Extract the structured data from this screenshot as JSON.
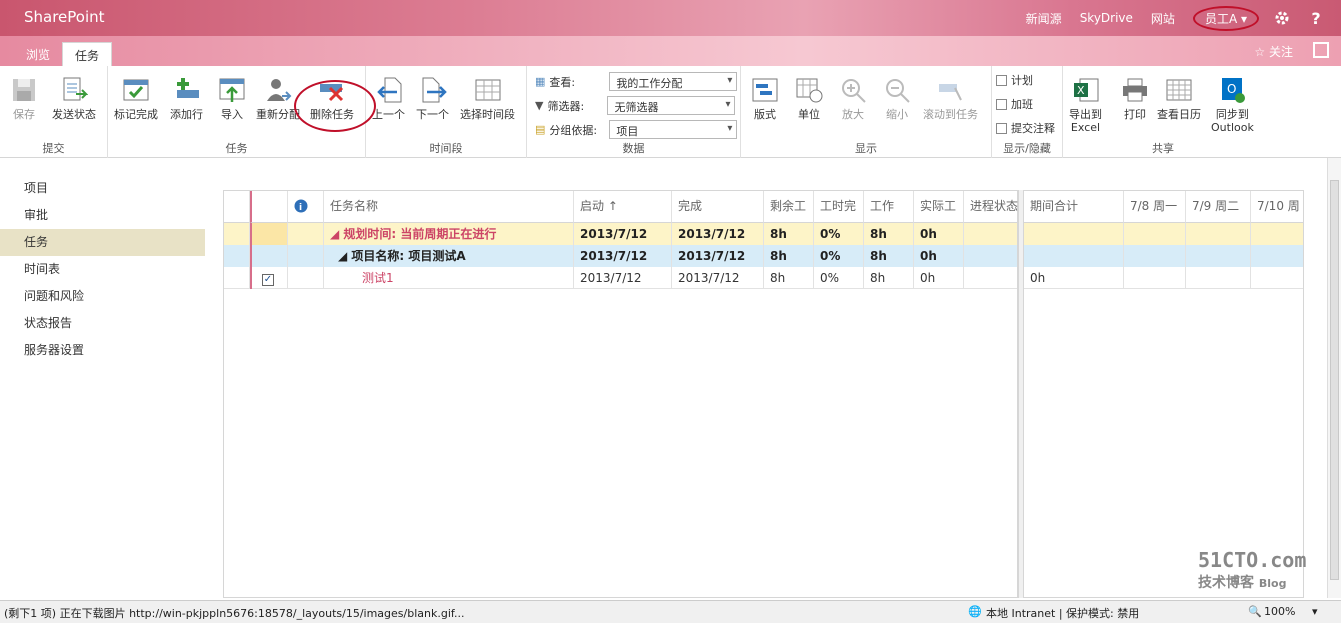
{
  "suite": {
    "brand": "SharePoint",
    "links": [
      "新闻源",
      "SkyDrive",
      "网站"
    ],
    "user": "员工A ▾",
    "settings_icon": "gear-icon",
    "help_label": "?"
  },
  "tabs": {
    "browse": "浏览",
    "task": "任务",
    "follow": "关注"
  },
  "ribbon": {
    "groups": {
      "submit": "提交",
      "task": "任务",
      "timespan": "时间段",
      "data": "数据",
      "display": "显示",
      "showhide": "显示/隐藏",
      "share": "共享"
    },
    "buttons": {
      "save": "保存",
      "send_status": "发送状态",
      "mark_complete": "标记完成",
      "add_row": "添加行",
      "import": "导入",
      "reassign": "重新分配",
      "delete_task": "删除任务",
      "prev": "上一个",
      "next": "下一个",
      "select_period": "选择时间段",
      "layout": "版式",
      "units": "单位",
      "zoom_in": "放大",
      "zoom_out": "缩小",
      "scroll_to_task": "滚动到任务",
      "export_excel_1": "导出到",
      "export_excel_2": "Excel",
      "print": "打印",
      "view_calendar": "查看日历",
      "sync_outlook_1": "同步到",
      "sync_outlook_2": "Outlook"
    },
    "data": {
      "view_label": "查看:",
      "view_value": "我的工作分配",
      "filter_label": "筛选器:",
      "filter_value": "无筛选器",
      "group_label": "分组依据:",
      "group_value": "项目"
    },
    "showhide": {
      "plan": "计划",
      "overtime": "加班",
      "submit_notes": "提交注释"
    }
  },
  "nav": [
    "项目",
    "审批",
    "任务",
    "时间表",
    "问题和风险",
    "状态报告",
    "服务器设置"
  ],
  "grid": {
    "headers": {
      "name": "任务名称",
      "start": "启动 ↑",
      "finish": "完成",
      "remaining": "剩余工",
      "pct_complete": "工时完",
      "work": "工作",
      "actual": "实际工",
      "status": "进程状态"
    },
    "rows": [
      {
        "name": "◢ 规划时间: 当前周期正在进行",
        "start": "2013/7/12",
        "finish": "2013/7/12",
        "remaining": "8h",
        "pct": "0%",
        "work": "8h",
        "actual": "0h"
      },
      {
        "name": "◢ 项目名称: 项目测试A",
        "start": "2013/7/12",
        "finish": "2013/7/12",
        "remaining": "8h",
        "pct": "0%",
        "work": "8h",
        "actual": "0h"
      },
      {
        "name": "测试1",
        "start": "2013/7/12",
        "finish": "2013/7/12",
        "remaining": "8h",
        "pct": "0%",
        "work": "8h",
        "actual": "0h"
      }
    ]
  },
  "timesheet": {
    "headers": [
      "期间合计",
      "7/8 周一",
      "7/9 周二",
      "7/10 周"
    ],
    "row3_total": "0h"
  },
  "status": {
    "left": "(剩下1 项) 正在下载图片 http://win-pkjppln5676:18578/_layouts/15/images/blank.gif...",
    "zone": "本地 Intranet | 保护模式: 禁用",
    "zoom": "100%"
  },
  "watermark": {
    "line1": "51CTO.com",
    "line2": "技术博客",
    "line3": "Blog"
  }
}
